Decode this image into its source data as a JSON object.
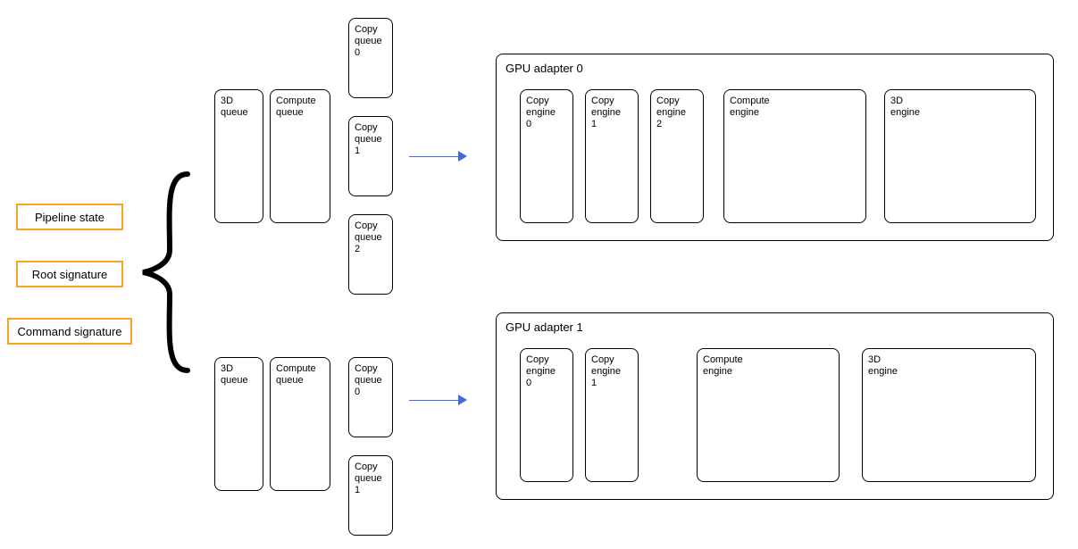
{
  "left": {
    "pipeline_state": "Pipeline state",
    "root_signature": "Root signature",
    "command_signature": "Command signature"
  },
  "queues": {
    "top": {
      "q3d": "3D\nqueue",
      "compute": "Compute\nqueue",
      "copy0": "Copy\nqueue\n0",
      "copy1": "Copy\nqueue\n1",
      "copy2": "Copy\nqueue\n2"
    },
    "bottom": {
      "q3d": "3D\nqueue",
      "compute": "Compute\nqueue",
      "copy0": "Copy\nqueue\n0",
      "copy1": "Copy\nqueue\n1"
    }
  },
  "gpu0": {
    "title": "GPU adapter 0",
    "engines": {
      "copy0": "Copy\nengine\n0",
      "copy1": "Copy\nengine\n1",
      "copy2": "Copy\nengine\n2",
      "compute": "Compute\nengine",
      "g3d": "3D\nengine"
    }
  },
  "gpu1": {
    "title": "GPU adapter 1",
    "engines": {
      "copy0": "Copy\nengine\n0",
      "copy1": "Copy\nengine\n1",
      "compute": "Compute\nengine",
      "g3d": "3D\nengine"
    }
  }
}
